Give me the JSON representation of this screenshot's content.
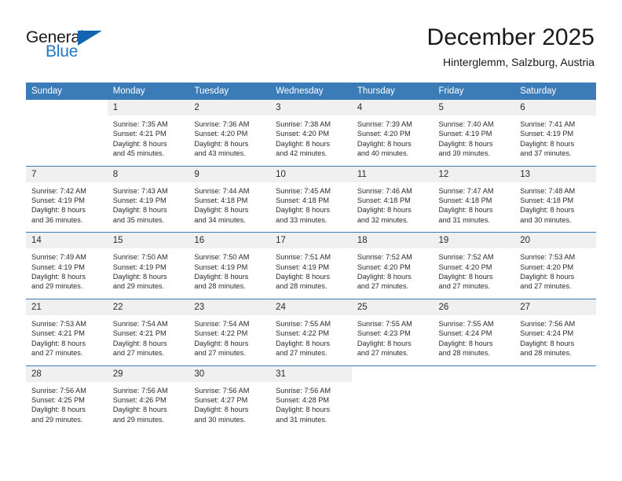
{
  "brand": {
    "name_part1": "General",
    "name_part2": "Blue",
    "color_primary": "#1565ae",
    "color_secondary": "#2079c7"
  },
  "header": {
    "title": "December 2025",
    "subtitle": "Hinterglemm, Salzburg, Austria",
    "header_bg": "#3b7cb8",
    "daynum_bg": "#f0f0f0"
  },
  "weekday_headers": [
    "Sunday",
    "Monday",
    "Tuesday",
    "Wednesday",
    "Thursday",
    "Friday",
    "Saturday"
  ],
  "weeks": [
    [
      {
        "day": "",
        "empty": true
      },
      {
        "day": "1",
        "sunrise": "Sunrise: 7:35 AM",
        "sunset": "Sunset: 4:21 PM",
        "daylight_line1": "Daylight: 8 hours",
        "daylight_line2": "and 45 minutes."
      },
      {
        "day": "2",
        "sunrise": "Sunrise: 7:36 AM",
        "sunset": "Sunset: 4:20 PM",
        "daylight_line1": "Daylight: 8 hours",
        "daylight_line2": "and 43 minutes."
      },
      {
        "day": "3",
        "sunrise": "Sunrise: 7:38 AM",
        "sunset": "Sunset: 4:20 PM",
        "daylight_line1": "Daylight: 8 hours",
        "daylight_line2": "and 42 minutes."
      },
      {
        "day": "4",
        "sunrise": "Sunrise: 7:39 AM",
        "sunset": "Sunset: 4:20 PM",
        "daylight_line1": "Daylight: 8 hours",
        "daylight_line2": "and 40 minutes."
      },
      {
        "day": "5",
        "sunrise": "Sunrise: 7:40 AM",
        "sunset": "Sunset: 4:19 PM",
        "daylight_line1": "Daylight: 8 hours",
        "daylight_line2": "and 39 minutes."
      },
      {
        "day": "6",
        "sunrise": "Sunrise: 7:41 AM",
        "sunset": "Sunset: 4:19 PM",
        "daylight_line1": "Daylight: 8 hours",
        "daylight_line2": "and 37 minutes."
      }
    ],
    [
      {
        "day": "7",
        "sunrise": "Sunrise: 7:42 AM",
        "sunset": "Sunset: 4:19 PM",
        "daylight_line1": "Daylight: 8 hours",
        "daylight_line2": "and 36 minutes."
      },
      {
        "day": "8",
        "sunrise": "Sunrise: 7:43 AM",
        "sunset": "Sunset: 4:19 PM",
        "daylight_line1": "Daylight: 8 hours",
        "daylight_line2": "and 35 minutes."
      },
      {
        "day": "9",
        "sunrise": "Sunrise: 7:44 AM",
        "sunset": "Sunset: 4:18 PM",
        "daylight_line1": "Daylight: 8 hours",
        "daylight_line2": "and 34 minutes."
      },
      {
        "day": "10",
        "sunrise": "Sunrise: 7:45 AM",
        "sunset": "Sunset: 4:18 PM",
        "daylight_line1": "Daylight: 8 hours",
        "daylight_line2": "and 33 minutes."
      },
      {
        "day": "11",
        "sunrise": "Sunrise: 7:46 AM",
        "sunset": "Sunset: 4:18 PM",
        "daylight_line1": "Daylight: 8 hours",
        "daylight_line2": "and 32 minutes."
      },
      {
        "day": "12",
        "sunrise": "Sunrise: 7:47 AM",
        "sunset": "Sunset: 4:18 PM",
        "daylight_line1": "Daylight: 8 hours",
        "daylight_line2": "and 31 minutes."
      },
      {
        "day": "13",
        "sunrise": "Sunrise: 7:48 AM",
        "sunset": "Sunset: 4:18 PM",
        "daylight_line1": "Daylight: 8 hours",
        "daylight_line2": "and 30 minutes."
      }
    ],
    [
      {
        "day": "14",
        "sunrise": "Sunrise: 7:49 AM",
        "sunset": "Sunset: 4:19 PM",
        "daylight_line1": "Daylight: 8 hours",
        "daylight_line2": "and 29 minutes."
      },
      {
        "day": "15",
        "sunrise": "Sunrise: 7:50 AM",
        "sunset": "Sunset: 4:19 PM",
        "daylight_line1": "Daylight: 8 hours",
        "daylight_line2": "and 29 minutes."
      },
      {
        "day": "16",
        "sunrise": "Sunrise: 7:50 AM",
        "sunset": "Sunset: 4:19 PM",
        "daylight_line1": "Daylight: 8 hours",
        "daylight_line2": "and 28 minutes."
      },
      {
        "day": "17",
        "sunrise": "Sunrise: 7:51 AM",
        "sunset": "Sunset: 4:19 PM",
        "daylight_line1": "Daylight: 8 hours",
        "daylight_line2": "and 28 minutes."
      },
      {
        "day": "18",
        "sunrise": "Sunrise: 7:52 AM",
        "sunset": "Sunset: 4:20 PM",
        "daylight_line1": "Daylight: 8 hours",
        "daylight_line2": "and 27 minutes."
      },
      {
        "day": "19",
        "sunrise": "Sunrise: 7:52 AM",
        "sunset": "Sunset: 4:20 PM",
        "daylight_line1": "Daylight: 8 hours",
        "daylight_line2": "and 27 minutes."
      },
      {
        "day": "20",
        "sunrise": "Sunrise: 7:53 AM",
        "sunset": "Sunset: 4:20 PM",
        "daylight_line1": "Daylight: 8 hours",
        "daylight_line2": "and 27 minutes."
      }
    ],
    [
      {
        "day": "21",
        "sunrise": "Sunrise: 7:53 AM",
        "sunset": "Sunset: 4:21 PM",
        "daylight_line1": "Daylight: 8 hours",
        "daylight_line2": "and 27 minutes."
      },
      {
        "day": "22",
        "sunrise": "Sunrise: 7:54 AM",
        "sunset": "Sunset: 4:21 PM",
        "daylight_line1": "Daylight: 8 hours",
        "daylight_line2": "and 27 minutes."
      },
      {
        "day": "23",
        "sunrise": "Sunrise: 7:54 AM",
        "sunset": "Sunset: 4:22 PM",
        "daylight_line1": "Daylight: 8 hours",
        "daylight_line2": "and 27 minutes."
      },
      {
        "day": "24",
        "sunrise": "Sunrise: 7:55 AM",
        "sunset": "Sunset: 4:22 PM",
        "daylight_line1": "Daylight: 8 hours",
        "daylight_line2": "and 27 minutes."
      },
      {
        "day": "25",
        "sunrise": "Sunrise: 7:55 AM",
        "sunset": "Sunset: 4:23 PM",
        "daylight_line1": "Daylight: 8 hours",
        "daylight_line2": "and 27 minutes."
      },
      {
        "day": "26",
        "sunrise": "Sunrise: 7:55 AM",
        "sunset": "Sunset: 4:24 PM",
        "daylight_line1": "Daylight: 8 hours",
        "daylight_line2": "and 28 minutes."
      },
      {
        "day": "27",
        "sunrise": "Sunrise: 7:56 AM",
        "sunset": "Sunset: 4:24 PM",
        "daylight_line1": "Daylight: 8 hours",
        "daylight_line2": "and 28 minutes."
      }
    ],
    [
      {
        "day": "28",
        "sunrise": "Sunrise: 7:56 AM",
        "sunset": "Sunset: 4:25 PM",
        "daylight_line1": "Daylight: 8 hours",
        "daylight_line2": "and 29 minutes."
      },
      {
        "day": "29",
        "sunrise": "Sunrise: 7:56 AM",
        "sunset": "Sunset: 4:26 PM",
        "daylight_line1": "Daylight: 8 hours",
        "daylight_line2": "and 29 minutes."
      },
      {
        "day": "30",
        "sunrise": "Sunrise: 7:56 AM",
        "sunset": "Sunset: 4:27 PM",
        "daylight_line1": "Daylight: 8 hours",
        "daylight_line2": "and 30 minutes."
      },
      {
        "day": "31",
        "sunrise": "Sunrise: 7:56 AM",
        "sunset": "Sunset: 4:28 PM",
        "daylight_line1": "Daylight: 8 hours",
        "daylight_line2": "and 31 minutes."
      },
      {
        "day": "",
        "empty": true
      },
      {
        "day": "",
        "empty": true
      },
      {
        "day": "",
        "empty": true
      }
    ]
  ]
}
